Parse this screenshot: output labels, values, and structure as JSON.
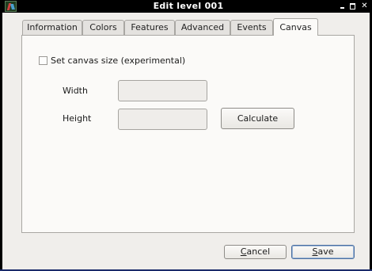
{
  "window": {
    "title": "Edit level 001",
    "minimize_glyph": "",
    "maximize_glyph": "",
    "close_glyph": "✕"
  },
  "tabs": [
    {
      "label": "Information",
      "active": false
    },
    {
      "label": "Colors",
      "active": false
    },
    {
      "label": "Features",
      "active": false
    },
    {
      "label": "Advanced",
      "active": false
    },
    {
      "label": "Events",
      "active": false
    },
    {
      "label": "Canvas",
      "active": true
    }
  ],
  "canvas": {
    "set_size_label": "Set canvas size (experimental)",
    "set_size_checked": false,
    "width_label": "Width",
    "width_value": "",
    "height_label": "Height",
    "height_value": "",
    "calculate_label": "Calculate"
  },
  "footer": {
    "cancel_mnemonic": "C",
    "cancel_rest": "ancel",
    "save_mnemonic": "S",
    "save_rest": "ave"
  },
  "icons": {
    "app": "app-icon",
    "minimize": "minimize-icon",
    "maximize": "maximize-icon",
    "close": "close-icon"
  }
}
